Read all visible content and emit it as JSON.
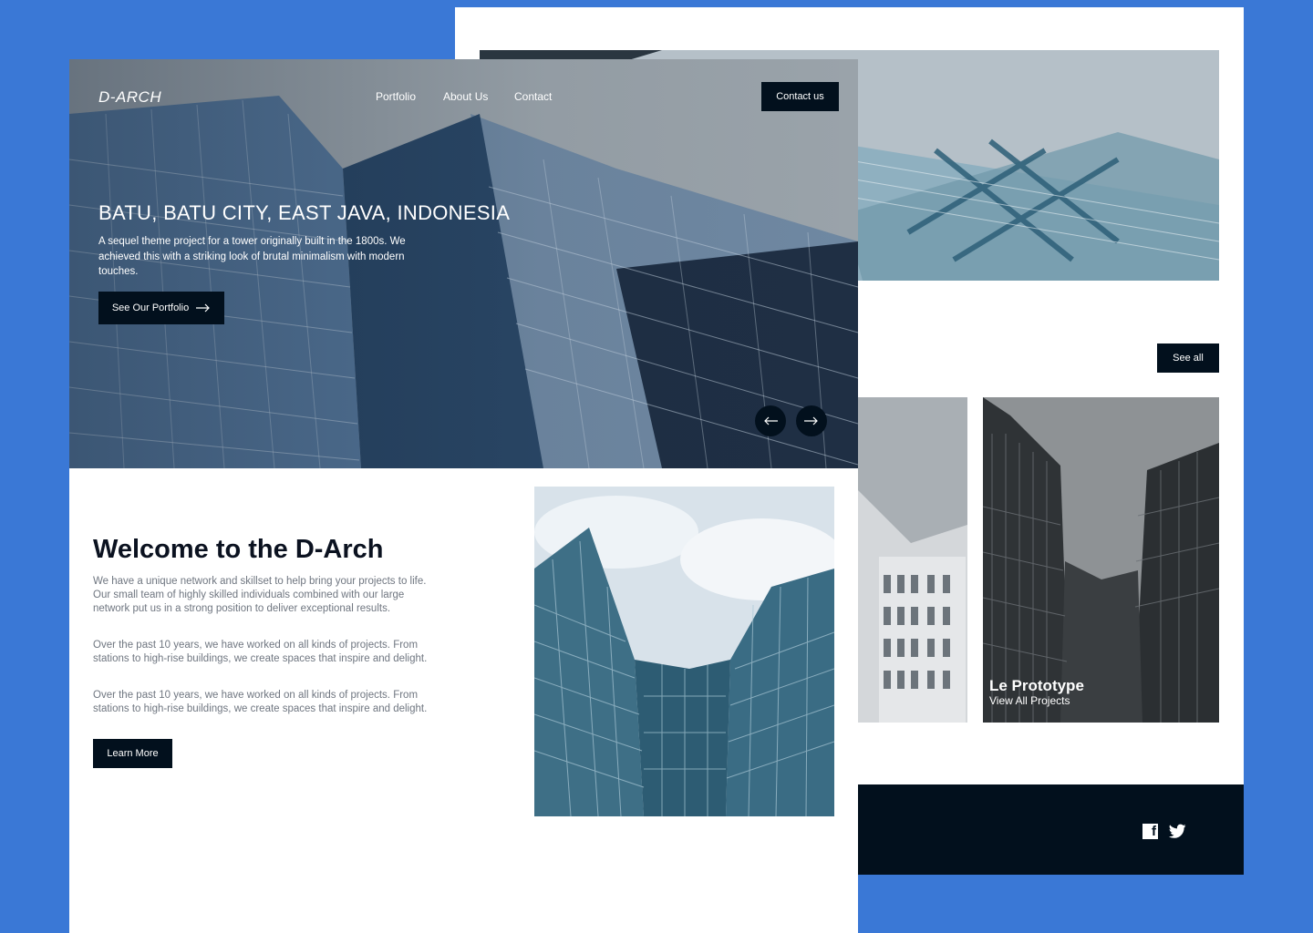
{
  "back": {
    "see_all": "See all",
    "project": {
      "title": "Le Prototype",
      "link": "View All Projects"
    },
    "footer": {
      "social": [
        "facebook-icon",
        "twitter-icon"
      ]
    }
  },
  "front": {
    "logo": "D-ARCH",
    "nav": {
      "portfolio": "Portfolio",
      "about": "About Us",
      "contact": "Contact"
    },
    "contact_button": "Contact us",
    "hero": {
      "heading": "BATU, BATU CITY, EAST JAVA, INDONESIA",
      "text": "A sequel theme project for a tower originally built in the 1800s. We achieved this with a striking look of brutal minimalism with modern touches.",
      "button": "See Our Portfolio"
    },
    "welcome": {
      "title": "Welcome to the D-Arch",
      "p1": "We have a unique network and skillset to help bring your projects to life. Our small team of highly skilled individuals combined with our large network put us in a strong position to deliver exceptional results.",
      "p2": "Over the past 10 years, we have worked on all kinds of projects. From stations to high-rise buildings, we create spaces that inspire and delight.",
      "p3": "Over the past 10 years, we have worked on all kinds of projects. From stations to high-rise buildings, we create spaces that inspire and delight.",
      "button": "Learn More"
    }
  },
  "colors": {
    "background": "#3A78D6",
    "dark": "#02101D",
    "white": "#FFFFFF"
  }
}
